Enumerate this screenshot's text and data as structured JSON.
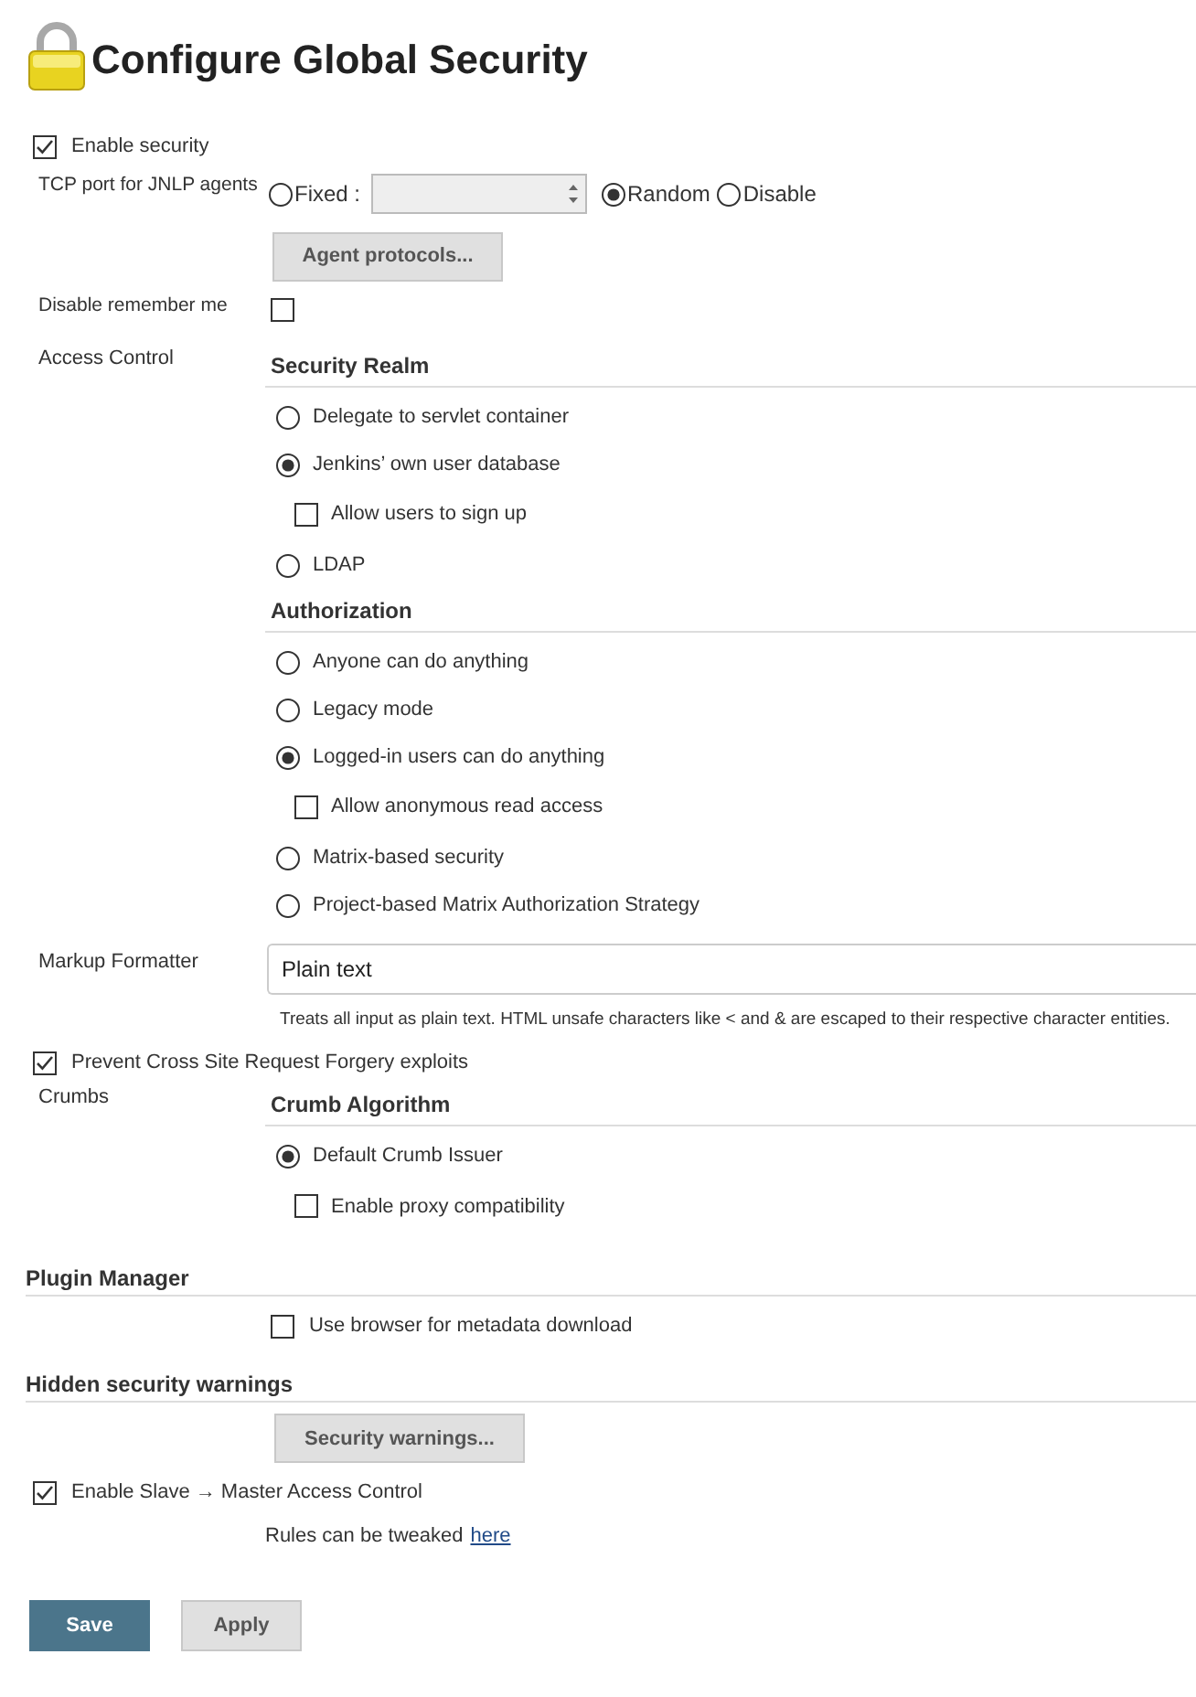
{
  "title": "Configure Global Security",
  "enable_security": {
    "label": "Enable security",
    "checked": true
  },
  "tcp_port": {
    "label": "TCP port for JNLP agents",
    "options": [
      {
        "label": "Fixed :",
        "selected": false,
        "kind": "field"
      },
      {
        "label": "Random",
        "selected": true,
        "kind": "plain"
      },
      {
        "label": "Disable",
        "selected": false,
        "kind": "plain"
      }
    ],
    "field_disabled": true
  },
  "agent_protocols_button": "Agent protocols...",
  "disable_remember_me": {
    "label": "Disable remember me",
    "checked": false
  },
  "access_control": {
    "label": "Access Control",
    "sections": [
      {
        "heading": "Security Realm",
        "options": [
          {
            "label": "Delegate to servlet container",
            "selected": false
          },
          {
            "label": "Jenkins’ own user database",
            "selected": true,
            "sub": {
              "label": "Allow users to sign up",
              "checked": false
            }
          },
          {
            "label": "LDAP",
            "selected": false
          }
        ]
      },
      {
        "heading": "Authorization",
        "options": [
          {
            "label": "Anyone can do anything",
            "selected": false
          },
          {
            "label": "Legacy mode",
            "selected": false
          },
          {
            "label": "Logged-in users can do anything",
            "selected": true,
            "sub": {
              "label": "Allow anonymous read access",
              "checked": false
            }
          },
          {
            "label": "Matrix-based security",
            "selected": false
          },
          {
            "label": "Project-based Matrix Authorization Strategy",
            "selected": false
          }
        ]
      }
    ]
  },
  "markup_formatter": {
    "label": "Markup Formatter",
    "value": "Plain text",
    "help": "Treats all input as plain text. HTML unsafe characters like < and & are escaped to their respective character entities."
  },
  "csrf": {
    "label": "Prevent Cross Site Request Forgery exploits",
    "checked": true
  },
  "crumbs": {
    "label": "Crumbs",
    "sections": [
      {
        "heading": "Crumb Algorithm",
        "options": [
          {
            "label": "Default Crumb Issuer",
            "selected": true,
            "sub": {
              "label": "Enable proxy compatibility",
              "checked": false
            }
          }
        ]
      }
    ]
  },
  "plugin_manager": {
    "heading": "Plugin Manager",
    "checkbox": {
      "label": "Use browser for metadata download",
      "checked": false
    }
  },
  "hidden_security_warnings": {
    "heading": "Hidden security warnings",
    "button": "Security warnings..."
  },
  "slave_master": {
    "label": "Enable Slave → Master Access Control",
    "checked": true,
    "note": "Rules can be tweaked",
    "link": "here"
  },
  "buttons": [
    {
      "label": "Save",
      "kind": "primary"
    },
    {
      "label": "Apply",
      "kind": "secondary"
    }
  ]
}
